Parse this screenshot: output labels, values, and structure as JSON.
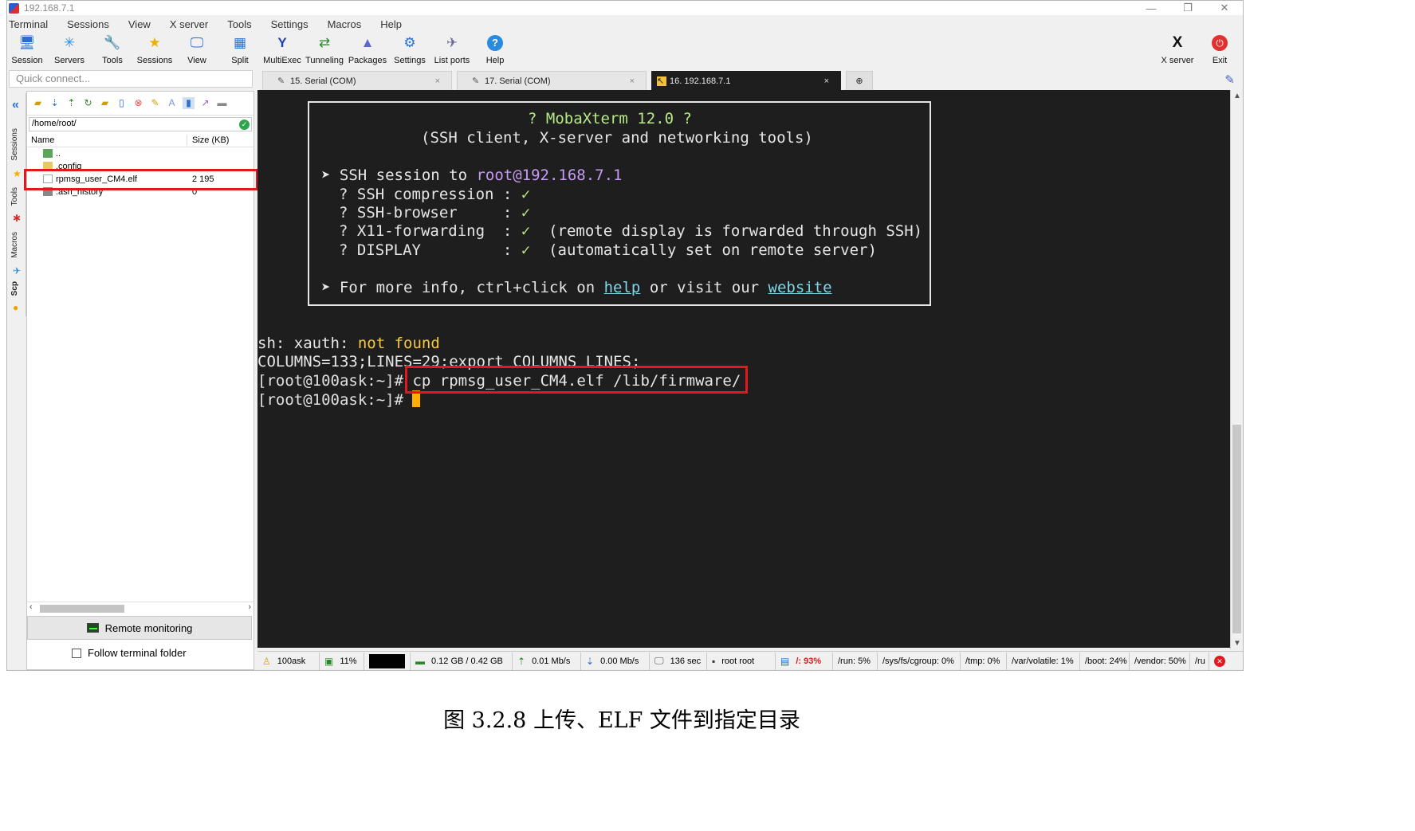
{
  "window": {
    "title": "192.168.7.1",
    "controls": [
      "—",
      "❐",
      "✕"
    ]
  },
  "menu": [
    "Terminal",
    "Sessions",
    "View",
    "X server",
    "Tools",
    "Settings",
    "Macros",
    "Help"
  ],
  "toolbar": {
    "buttons": [
      {
        "label": "Session",
        "icon": "🖥"
      },
      {
        "label": "Servers",
        "icon": "✳"
      },
      {
        "label": "Tools",
        "icon": "🔧"
      },
      {
        "label": "Sessions",
        "icon": "★"
      },
      {
        "label": "View",
        "icon": "🖵"
      },
      {
        "label": "Split",
        "icon": "▦"
      },
      {
        "label": "MultiExec",
        "icon": "Y"
      },
      {
        "label": "Tunneling",
        "icon": "⇄"
      },
      {
        "label": "Packages",
        "icon": "▲"
      },
      {
        "label": "Settings",
        "icon": "⚙"
      },
      {
        "label": "List ports",
        "icon": "✈"
      },
      {
        "label": "Help",
        "icon": "?"
      }
    ],
    "right_buttons": [
      {
        "label": "X server",
        "icon": "X"
      },
      {
        "label": "Exit",
        "icon": "⏻"
      }
    ]
  },
  "quick_connect": {
    "placeholder": "Quick connect..."
  },
  "tabs": [
    {
      "label": "15. Serial (COM)",
      "close": "×"
    },
    {
      "label": "17. Serial (COM)",
      "close": "×"
    },
    {
      "label": "16. 192.168.7.1",
      "close": "×"
    }
  ],
  "tab_add": "⊕",
  "sidebar": {
    "vtabs": [
      "Sessions",
      "Tools",
      "Macros",
      "Scp"
    ]
  },
  "file_browser": {
    "path": "/home/root/",
    "columns": [
      "Name",
      "Size (KB)"
    ],
    "rows": [
      {
        "name": "..",
        "size": ""
      },
      {
        "name": ".config",
        "size": ""
      },
      {
        "name": "rpmsg_user_CM4.elf",
        "size": "2 195"
      },
      {
        "name": ".ash_history",
        "size": "0"
      }
    ],
    "remote_monitoring": "Remote monitoring",
    "follow_folder": "Follow terminal folder"
  },
  "terminal": {
    "banner_title": "? MobaXterm 12.0 ?",
    "banner_subtitle": "(SSH client, X-server and networking tools)",
    "session_prefix": "➤ SSH session to ",
    "session_target": "root@192.168.7.1",
    "features": [
      {
        "name": "? SSH compression : ",
        "check": "✓",
        "note": ""
      },
      {
        "name": "? SSH-browser     : ",
        "check": "✓",
        "note": ""
      },
      {
        "name": "? X11-forwarding  : ",
        "check": "✓",
        "note": "  (remote display is forwarded through SSH)"
      },
      {
        "name": "? DISPLAY         : ",
        "check": "✓",
        "note": "  (automatically set on remote server)"
      }
    ],
    "info_prefix": "➤ For more info, ctrl+click on ",
    "info_help": "help",
    "info_mid": " or visit our ",
    "info_website": "website",
    "xauth_prefix": "sh: xauth: ",
    "xauth_msg": "not found",
    "columns_line": "COLUMNS=133;LINES=29;export COLUMNS LINES;",
    "prompt": "[root@100ask:~]# ",
    "command": "cp rpmsg_user_CM4.elf /lib/firmware/"
  },
  "status_bar": [
    {
      "icon": "♙",
      "text": "100ask"
    },
    {
      "icon": "▣",
      "text": "11%"
    },
    {
      "icon": "▬",
      "text": "0.12 GB / 0.42 GB"
    },
    {
      "icon": "⇡",
      "text": "0.01 Mb/s"
    },
    {
      "icon": "⇣",
      "text": "0.00 Mb/s"
    },
    {
      "icon": "🖵",
      "text": "136 sec"
    },
    {
      "icon": "▪",
      "text": "root  root"
    },
    {
      "icon": "▤",
      "text": "/: 93%"
    },
    {
      "icon": "",
      "text": "/run: 5%"
    },
    {
      "icon": "",
      "text": "/sys/fs/cgroup: 0%"
    },
    {
      "icon": "",
      "text": "/tmp: 0%"
    },
    {
      "icon": "",
      "text": "/var/volatile: 1%"
    },
    {
      "icon": "",
      "text": "/boot: 24%"
    },
    {
      "icon": "",
      "text": "/vendor: 50%"
    },
    {
      "icon": "",
      "text": "/ru"
    }
  ],
  "caption": "图 3.2.8 上传、ELF 文件到指定目录",
  "colors": {
    "highlight": "#e0191e",
    "terminal_bg": "#1e1e1e",
    "cursor": "#ffb000"
  }
}
